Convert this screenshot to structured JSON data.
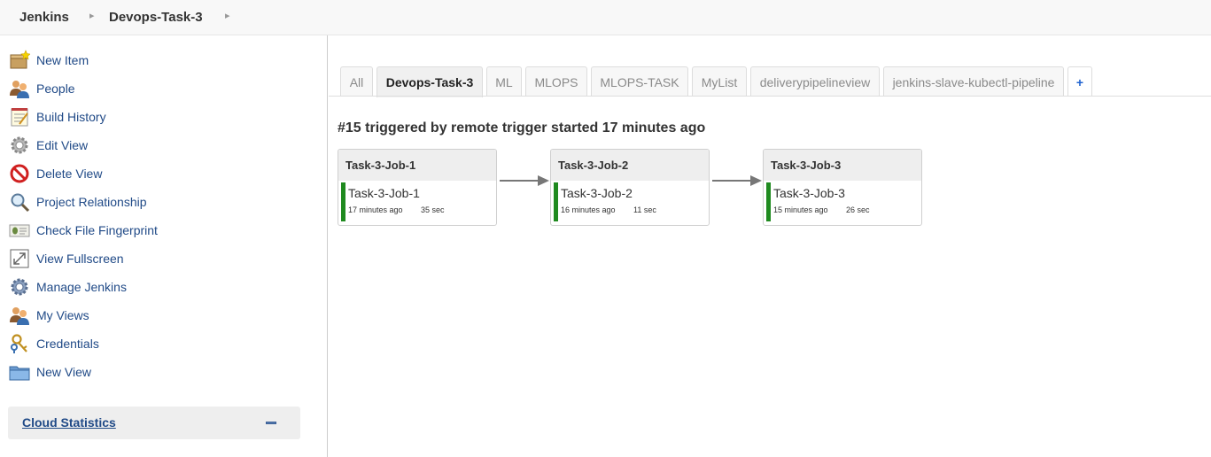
{
  "breadcrumb": {
    "home": "Jenkins",
    "view": "Devops-Task-3"
  },
  "sidebar": {
    "items": [
      {
        "label": "New Item",
        "icon": "new-item-icon"
      },
      {
        "label": "People",
        "icon": "people-icon"
      },
      {
        "label": "Build History",
        "icon": "notepad-icon"
      },
      {
        "label": "Edit View",
        "icon": "gear-icon"
      },
      {
        "label": "Delete View",
        "icon": "no-entry-icon"
      },
      {
        "label": "Project Relationship",
        "icon": "magnifier-icon"
      },
      {
        "label": "Check File Fingerprint",
        "icon": "fingerprint-icon"
      },
      {
        "label": "View Fullscreen",
        "icon": "fullscreen-icon"
      },
      {
        "label": "Manage Jenkins",
        "icon": "gear-icon"
      },
      {
        "label": "My Views",
        "icon": "people-icon"
      },
      {
        "label": "Credentials",
        "icon": "keys-icon"
      },
      {
        "label": "New View",
        "icon": "folder-icon"
      }
    ],
    "cloud_statistics": "Cloud Statistics"
  },
  "tabs": [
    {
      "label": "All",
      "active": false
    },
    {
      "label": "Devops-Task-3",
      "active": true
    },
    {
      "label": "ML",
      "active": false
    },
    {
      "label": "MLOPS",
      "active": false
    },
    {
      "label": "MLOPS-TASK",
      "active": false
    },
    {
      "label": "MyList",
      "active": false
    },
    {
      "label": "deliverypipelineview",
      "active": false
    },
    {
      "label": "jenkins-slave-kubectl-pipeline",
      "active": false
    },
    {
      "label": "+",
      "active": false
    }
  ],
  "pipeline": {
    "title": "#15 triggered by remote trigger started 17 minutes ago",
    "jobs": [
      {
        "header": "Task-3-Job-1",
        "name": "Task-3-Job-1",
        "time": "17 minutes ago",
        "duration": "35 sec",
        "status_color": "#1f8a1f"
      },
      {
        "header": "Task-3-Job-2",
        "name": "Task-3-Job-2",
        "time": "16 minutes ago",
        "duration": "11 sec",
        "status_color": "#1f8a1f"
      },
      {
        "header": "Task-3-Job-3",
        "name": "Task-3-Job-3",
        "time": "15 minutes ago",
        "duration": "26 sec",
        "status_color": "#1f8a1f"
      }
    ]
  },
  "colors": {
    "link": "#204a87",
    "success": "#1f8a1f",
    "plus_tab": "#1e62d0"
  }
}
